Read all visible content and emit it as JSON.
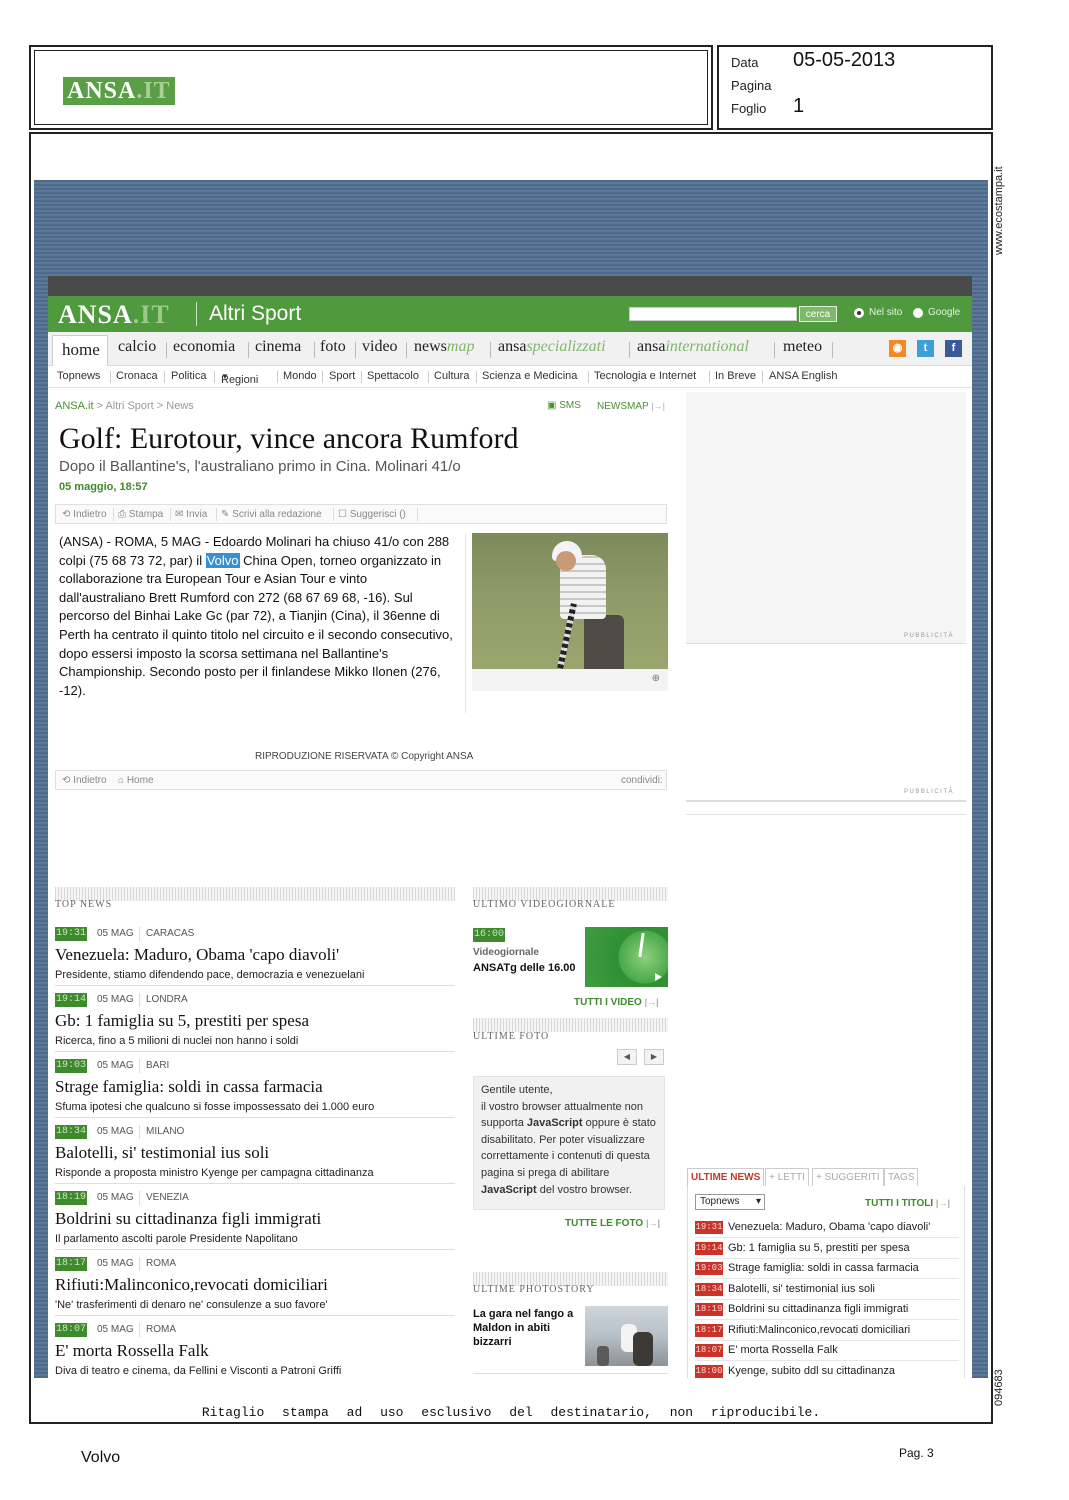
{
  "clipping": {
    "logo_main": "ANSA",
    "logo_suffix": ".IT",
    "labels": {
      "data": "Data",
      "pagina": "Pagina",
      "foglio": "Foglio"
    },
    "data_value": "05-05-2013",
    "pagina_value": "",
    "foglio_value": "1",
    "side_url": "www.ecostampa.it",
    "side_code": "094683",
    "notice": "Ritaglio stampa ad uso esclusivo del destinatario, non riproducibile.",
    "footer_keyword": "Volvo",
    "footer_page": "Pag. 3"
  },
  "site": {
    "logo_main": "ANSA",
    "logo_suffix": ".IT",
    "section": "Altri Sport",
    "search_button": "cerca",
    "search_placeholder": "",
    "radio_site": "Nel sito",
    "radio_google": "Google",
    "nav": [
      "home",
      "calcio",
      "economia",
      "cinema",
      "foto",
      "video",
      "news",
      "map",
      "ansa",
      "specializzati",
      "ansa",
      "international",
      "meteo"
    ],
    "subnav": [
      "Topnews",
      "Cronaca",
      "Politica",
      "Regioni",
      "Mondo",
      "Sport",
      "Spettacolo",
      "Cultura",
      "Scienza e Medicina",
      "Tecnologia e Internet",
      "In Breve",
      "ANSA English"
    ],
    "social": {
      "rss": "rss-icon",
      "twitter": "twitter-icon",
      "facebook": "facebook-icon"
    }
  },
  "article": {
    "breadcrumb_home": "ANSA.it",
    "breadcrumb_rest": " > Altri Sport > News",
    "sms": "SMS",
    "newsmap": "NEWSMAP",
    "title": "Golf: Eurotour, vince ancora Rumford",
    "subtitle": "Dopo il Ballantine's, l'australiano primo in Cina. Molinari 41/o",
    "date": "05 maggio, 18:57",
    "tools": [
      "Indietro",
      "Stampa",
      "Invia",
      "Scrivi alla redazione",
      "Suggerisci ()"
    ],
    "body_before": "(ANSA) - ROMA, 5 MAG - Edoardo Molinari ha chiuso 41/o con 288 colpi (75 68 73 72, par) il ",
    "body_highlight": "Volvo",
    "body_after": " China Open, torneo organizzato in collaborazione tra European Tour e Asian Tour e vinto dall'australiano Brett Rumford con 272 (68 67 69 68, -16). Sul percorso del Binhai Lake Gc (par 72), a Tianjin (Cina), il 36enne di Perth ha centrato il quinto titolo nel circuito e il secondo consecutivo, dopo essersi imposto la scorsa settimana nel Ballantine's Championship. Secondo posto per il finlandese Mikko Ilonen (276, -12).",
    "copyright": "RIPRODUZIONE RISERVATA © Copyright ANSA",
    "bottom_tools": [
      "Indietro",
      "Home"
    ],
    "share": "condividi:",
    "ad_label": "PUBBLICITÀ"
  },
  "top_news": {
    "title": "TOP NEWS",
    "items": [
      {
        "time": "19:31",
        "date": "05 MAG",
        "place": "CARACAS",
        "headline": "Venezuela: Maduro, Obama 'capo diavoli'",
        "desc": "Presidente, stiamo difendendo pace, democrazia e venezuelani"
      },
      {
        "time": "19:14",
        "date": "05 MAG",
        "place": "LONDRA",
        "headline": "Gb: 1 famiglia su 5, prestiti per spesa",
        "desc": "Ricerca, fino a 5 milioni di nuclei non hanno i soldi"
      },
      {
        "time": "19:03",
        "date": "05 MAG",
        "place": "BARI",
        "headline": "Strage famiglia: soldi in cassa farmacia",
        "desc": "Sfuma ipotesi che qualcuno si fosse impossessato dei 1.000 euro"
      },
      {
        "time": "18:34",
        "date": "05 MAG",
        "place": "MILANO",
        "headline": "Balotelli, si' testimonial ius soli",
        "desc": "Risponde a proposta ministro Kyenge per campagna cittadinanza"
      },
      {
        "time": "18:19",
        "date": "05 MAG",
        "place": "VENEZIA",
        "headline": "Boldrini su cittadinanza figli immigrati",
        "desc": "Il parlamento ascolti parole Presidente Napolitano"
      },
      {
        "time": "18:17",
        "date": "05 MAG",
        "place": "ROMA",
        "headline": "Rifiuti:Malinconico,revocati domiciliari",
        "desc": "'Ne' trasferimenti di denaro ne' consulenze a suo favore'"
      },
      {
        "time": "18:07",
        "date": "05 MAG",
        "place": "ROMA",
        "headline": "E' morta Rossella Falk",
        "desc": "Diva di teatro e cinema, da Fellini e Visconti a Patroni Griffi"
      }
    ]
  },
  "video": {
    "title": "ULTIMO VIDEOGIORNALE",
    "time": "16:00",
    "label1": "Videogiornale",
    "label2": "ANSATg delle 16.00",
    "all_link": "TUTTI I VIDEO"
  },
  "photos": {
    "title": "ULTIME FOTO",
    "prev": "◀",
    "next": "▶",
    "js_before": "Gentile utente,\nil vostro browser attualmente non supporta ",
    "js_bold1": "JavaScript",
    "js_mid": " oppure è stato disabilitato. Per poter visualizzare correttamente i contenuti di questa pagina si prega di abilitare ",
    "js_bold2": "JavaScript",
    "js_after": " del vostro browser.",
    "all_link": "TUTTE LE FOTO"
  },
  "photostory": {
    "title": "ULTIME PHOTOSTORY",
    "caption": "La gara nel fango a Maldon in abiti bizzarri"
  },
  "ultime": {
    "tabs": [
      "ULTIME NEWS",
      "+ LETTI",
      "+ SUGGERITI",
      "TAGS"
    ],
    "select_value": "Topnews",
    "all_link": "TUTTI I TITOLI",
    "items": [
      {
        "time": "19:31",
        "headline": "Venezuela: Maduro, Obama 'capo diavoli'"
      },
      {
        "time": "19:14",
        "headline": "Gb: 1 famiglia su 5, prestiti per spesa"
      },
      {
        "time": "19:03",
        "headline": "Strage famiglia: soldi in cassa farmacia"
      },
      {
        "time": "18:34",
        "headline": "Balotelli, si' testimonial ius soli"
      },
      {
        "time": "18:19",
        "headline": "Boldrini su cittadinanza figli immigrati"
      },
      {
        "time": "18:17",
        "headline": "Rifiuti:Malinconico,revocati domiciliari"
      },
      {
        "time": "18:07",
        "headline": "E' morta Rossella Falk"
      },
      {
        "time": "18:00",
        "headline": "Kyenge, subito ddl su cittadinanza"
      }
    ]
  },
  "colors": {
    "ansa_green": "#4e9a3c",
    "time_green": "#3e8a2c",
    "time_red": "#c9332a",
    "highlight_blue": "#3a8fd1",
    "background_blue": "#4d6a8a"
  }
}
